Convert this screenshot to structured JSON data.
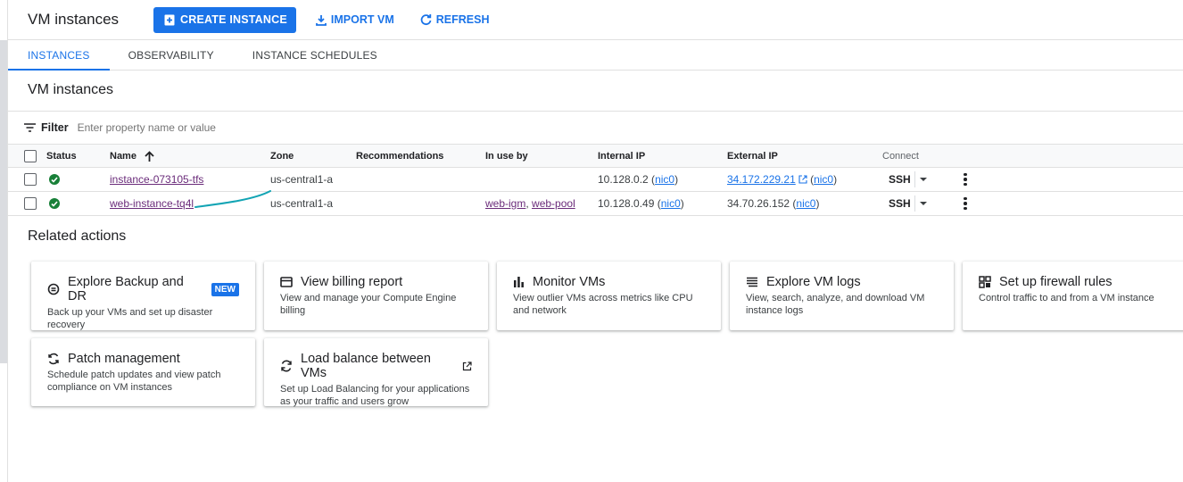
{
  "header": {
    "title": "VM instances",
    "create_label": "CREATE INSTANCE",
    "import_label": "IMPORT VM",
    "refresh_label": "REFRESH"
  },
  "tabs": [
    {
      "label": "INSTANCES",
      "active": true
    },
    {
      "label": "OBSERVABILITY",
      "active": false
    },
    {
      "label": "INSTANCE SCHEDULES",
      "active": false
    }
  ],
  "section_title": "VM instances",
  "filter": {
    "label": "Filter",
    "placeholder": "Enter property name or value"
  },
  "table": {
    "columns": {
      "status": "Status",
      "name": "Name",
      "zone": "Zone",
      "recommendations": "Recommendations",
      "in_use_by": "In use by",
      "internal_ip": "Internal IP",
      "external_ip": "External IP",
      "connect": "Connect"
    },
    "rows": [
      {
        "name": "instance-073105-tfs",
        "zone": "us-central1-a",
        "recommendations": "",
        "in_use_by": [],
        "internal_ip": "10.128.0.2",
        "internal_nic": "nic0",
        "external_ip": "34.172.229.21",
        "external_nic": "nic0",
        "connect": "SSH"
      },
      {
        "name": "web-instance-tq4l",
        "zone": "us-central1-a",
        "recommendations": "",
        "in_use_by": [
          "web-igm",
          "web-pool"
        ],
        "internal_ip": "10.128.0.49",
        "internal_nic": "nic0",
        "external_ip": "34.70.26.152",
        "external_nic": "nic0",
        "connect": "SSH"
      }
    ]
  },
  "related": {
    "title": "Related actions",
    "cards": [
      {
        "title": "Explore Backup and DR",
        "badge": "NEW",
        "desc": "Back up your VMs and set up disaster recovery",
        "icon": "backup-icon"
      },
      {
        "title": "View billing report",
        "desc": "View and manage your Compute Engine billing",
        "icon": "billing-icon"
      },
      {
        "title": "Monitor VMs",
        "desc": "View outlier VMs across metrics like CPU and network",
        "icon": "bar-chart-icon"
      },
      {
        "title": "Explore VM logs",
        "desc": "View, search, analyze, and download VM instance logs",
        "icon": "logs-icon"
      },
      {
        "title": "Set up firewall rules",
        "desc": "Control traffic to and from a VM instance",
        "icon": "firewall-icon"
      },
      {
        "title": "Patch management",
        "desc": "Schedule patch updates and view patch compliance on VM instances",
        "icon": "patch-icon"
      },
      {
        "title": "Load balance between VMs",
        "desc": "Set up Load Balancing for your applications as your traffic and users grow",
        "icon": "load-balance-icon",
        "external": true
      }
    ]
  },
  "colors": {
    "primary": "#1a73e8",
    "status_ok": "#188038",
    "visited_link": "#6a2b7a",
    "annotation_stroke": "#12a4b4"
  }
}
